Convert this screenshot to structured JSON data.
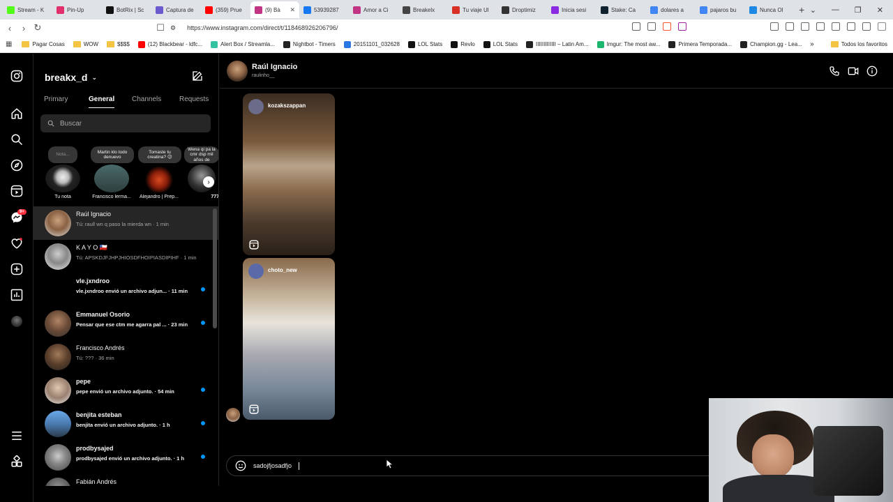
{
  "browser": {
    "tabs": [
      {
        "title": "Stream - K",
        "color": "#53fc18"
      },
      {
        "title": "Pin-Up",
        "color": "#e1306c"
      },
      {
        "title": "BotRix | Sc",
        "color": "#111111"
      },
      {
        "title": "Captura de",
        "color": "#6a5acd"
      },
      {
        "title": "(359) Prue",
        "color": "#ff0000"
      },
      {
        "title": "(9) Bà",
        "color": "#c13584"
      },
      {
        "title": "53939287",
        "color": "#1877f2"
      },
      {
        "title": "Amor a Ci",
        "color": "#c13584"
      },
      {
        "title": "Breakelx",
        "color": "#444444"
      },
      {
        "title": "Tu viaje Ul",
        "color": "#d93025"
      },
      {
        "title": "Droptimiz",
        "color": "#333333"
      },
      {
        "title": "Inicia sesi",
        "color": "#8a2be2"
      },
      {
        "title": "Stake: Ca",
        "color": "#0f212e"
      },
      {
        "title": "dolares a",
        "color": "#4285f4"
      },
      {
        "title": "pajaros bu",
        "color": "#4285f4"
      },
      {
        "title": "Nunca Ol",
        "color": "#1e88e5"
      }
    ],
    "active_tab_index": 5,
    "new_tab": "+",
    "url": "https://www.instagram.com/direct/t/118468926206796/",
    "bookmarks": [
      {
        "label": "Pagar Cosas",
        "kind": "folder"
      },
      {
        "label": "WOW",
        "kind": "folder"
      },
      {
        "label": "$$$$",
        "kind": "folder"
      },
      {
        "label": "(12) Blackbear - ldfc...",
        "kind": "site",
        "color": "#ff0000"
      },
      {
        "label": "Alert Box / Streamla...",
        "kind": "site",
        "color": "#31c3a2"
      },
      {
        "label": "Nightbot - Timers",
        "kind": "site",
        "color": "#222222"
      },
      {
        "label": "20151101_032628",
        "kind": "site",
        "color": "#2b78e4"
      },
      {
        "label": "LOL Stats",
        "kind": "site",
        "color": "#111111"
      },
      {
        "label": "Revlo",
        "kind": "site",
        "color": "#111111"
      },
      {
        "label": "LOL Stats",
        "kind": "site",
        "color": "#111111"
      },
      {
        "label": "IIIIIIIIIIIII – Latin Am...",
        "kind": "site",
        "color": "#222222"
      },
      {
        "label": "Imgur: The most aw...",
        "kind": "site",
        "color": "#1bb76e"
      },
      {
        "label": "Primera Temporada...",
        "kind": "site",
        "color": "#222222"
      },
      {
        "label": "Champion.gg - Lea...",
        "kind": "site",
        "color": "#222222"
      }
    ],
    "overflow": "»",
    "all_bookmarks": "Todos los favoritos"
  },
  "inbox": {
    "account": "breakx_d",
    "tabs": [
      "Primary",
      "General",
      "Channels",
      "Requests"
    ],
    "active_tab": 1,
    "search_placeholder": "Buscar",
    "notes": [
      {
        "text": "Nota...",
        "name": "Tu nota"
      },
      {
        "text": "Martin klo todo denuevo",
        "name": "Francisco lerma..."
      },
      {
        "text": "Tomaste tu creatina? 😉",
        "name": "Alejandro | Prep..."
      },
      {
        "text": "Wena qi pa la cmr dsp mil años de",
        "name": "777"
      }
    ],
    "conversations": [
      {
        "name": "Raúl Ignacio",
        "preview": "Tú: raull wn q paso la mierda wn · 1 min",
        "unread": false,
        "selected": true
      },
      {
        "name": "K A Y O 🇨🇱",
        "preview": "Tú: APSKDJFJHPJHIOSDFHOIPIASDIPIHF · 1 min",
        "unread": false,
        "selected": false
      },
      {
        "name": "vle.jxndroo",
        "preview": "vle.jxndroo envió un archivo adjun... · 11 min",
        "unread": true,
        "selected": false
      },
      {
        "name": "Emmanuel Osorio",
        "preview": "Pensar que ese ctm me agarra pal ... · 23 min",
        "unread": true,
        "selected": false
      },
      {
        "name": "Francisco Andrés",
        "preview": "Tú: ??? · 36 min",
        "unread": false,
        "selected": false
      },
      {
        "name": "pepe",
        "preview": "pepe envió un archivo adjunto. · 54 min",
        "unread": true,
        "selected": false
      },
      {
        "name": "benjita esteban",
        "preview": "benjita envió un archivo adjunto. · 1 h",
        "unread": true,
        "selected": false
      },
      {
        "name": "prodbysajed",
        "preview": "prodbysajed envió un archivo adjunto. · 1 h",
        "unread": true,
        "selected": false
      },
      {
        "name": "Fabián Andrés",
        "preview": "",
        "unread": false,
        "selected": false
      }
    ]
  },
  "rail": {
    "notification_badge": "9+"
  },
  "chat": {
    "name": "Raúl Ignacio",
    "username": "raulinho__",
    "reels": [
      {
        "user": "kozakszappan"
      },
      {
        "user": "choto_new"
      }
    ],
    "composer_value": "sadojfjosadfjo"
  }
}
